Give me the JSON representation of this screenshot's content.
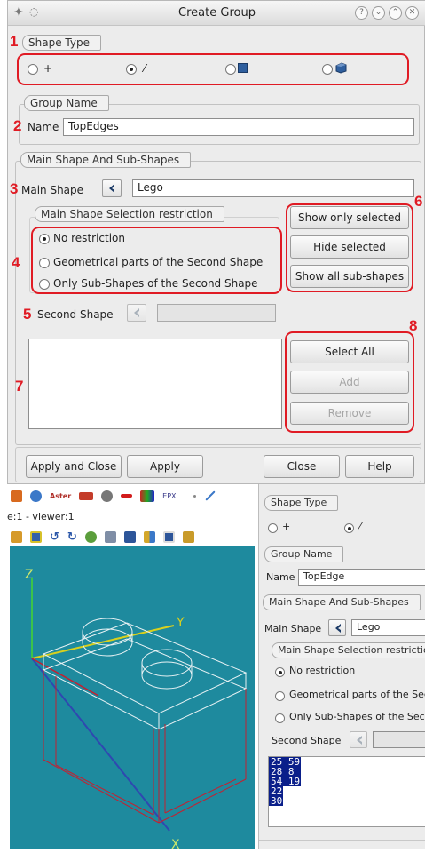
{
  "dialog": {
    "title": "Create Group",
    "shape_type_label": "Shape Type",
    "shape_types": [
      "+",
      "⁄",
      "■",
      "◆"
    ],
    "group_name_label": "Group Name",
    "name_label": "Name",
    "name_value": "TopEdges",
    "main_sub_label": "Main Shape And Sub-Shapes",
    "main_shape_label": "Main Shape",
    "main_shape_value": "Lego",
    "restriction_label": "Main Shape Selection restriction",
    "restrictions": [
      "No restriction",
      "Geometrical parts of the Second Shape",
      "Only Sub-Shapes of the Second Shape"
    ],
    "second_shape_label": "Second Shape",
    "second_shape_value": "",
    "side_buttons": [
      "Show only selected",
      "Hide selected",
      "Show all sub-shapes"
    ],
    "list_buttons": [
      "Select All",
      "Add",
      "Remove"
    ],
    "footer_buttons": [
      "Apply and Close",
      "Apply",
      "Close",
      "Help"
    ]
  },
  "annotations": [
    "1",
    "2",
    "3",
    "4",
    "5",
    "6",
    "7",
    "8"
  ],
  "bottom": {
    "viewer_title": "e:1 - viewer:1",
    "toolbar_texts": [
      "Aster",
      "EPX"
    ],
    "axis_labels": {
      "z": "Z",
      "y": "Y",
      "x": "X"
    },
    "panel": {
      "shape_type_label": "Shape Type",
      "shape_types": [
        "+",
        "⁄"
      ],
      "group_name_label": "Group Name",
      "name_label": "Name",
      "name_value": "TopEdge",
      "main_sub_label": "Main Shape And Sub-Shapes",
      "main_shape_label": "Main Shape",
      "main_shape_value": "Lego",
      "restriction_label": "Main Shape Selection restriction",
      "restrictions": [
        "No restriction",
        "Geometrical parts of the Secor",
        "Only Sub-Shapes of the Seconc"
      ],
      "second_shape_label": "Second Shape",
      "list_items": [
        "25 59",
        "28 8",
        "54 19",
        "22",
        "30"
      ]
    }
  },
  "colors": {
    "annotation": "#e01b24",
    "viewer_bg": "#1e8a9e",
    "selection": "#0a1f8a"
  }
}
